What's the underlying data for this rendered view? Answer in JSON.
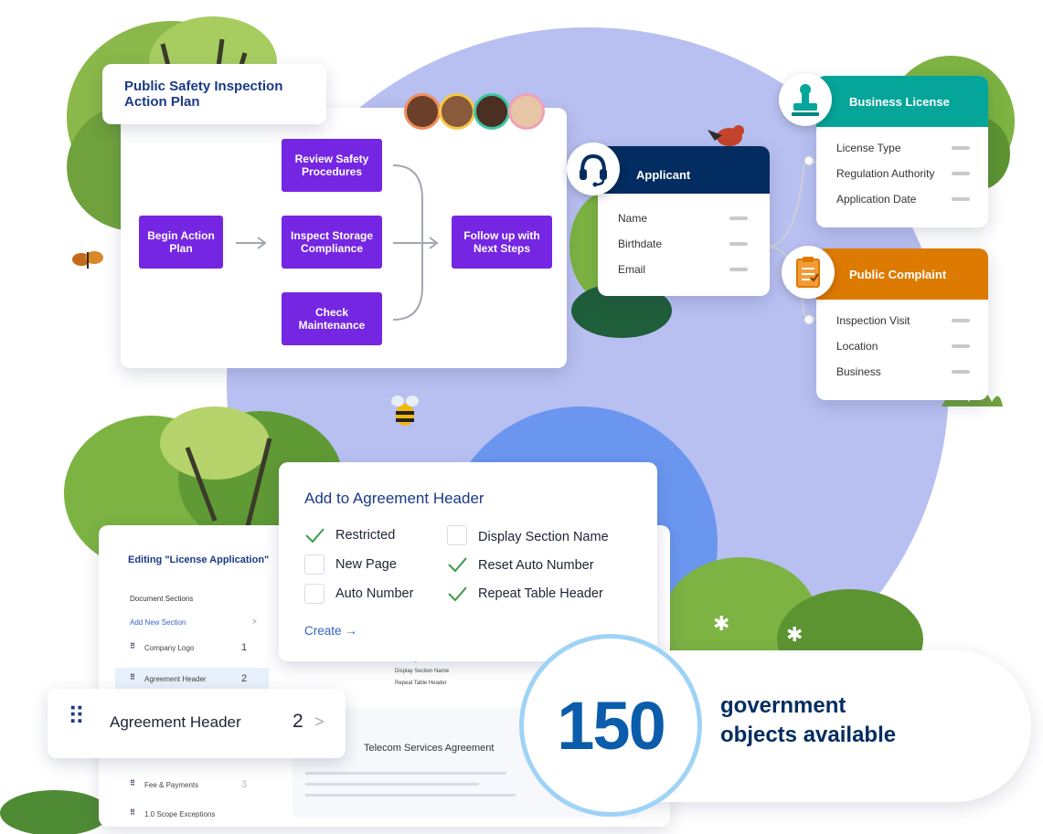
{
  "action_plan": {
    "title": "Public Safety Inspection Action Plan",
    "steps": {
      "begin": "Begin Action Plan",
      "review": "Review Safety Procedures",
      "inspect": "Inspect Storage Compliance",
      "check": "Check Maintenance",
      "follow": "Follow up with Next Steps"
    }
  },
  "applicant": {
    "title": "Applicant",
    "icon": "headset-icon",
    "color": "#032d60",
    "fields": [
      "Name",
      "Birthdate",
      "Email"
    ]
  },
  "business_license": {
    "title": "Business License",
    "icon": "stamp-icon",
    "color": "#06a59a",
    "fields": [
      "License Type",
      "Regulation Authority",
      "Application Date"
    ]
  },
  "public_complaint": {
    "title": "Public Complaint",
    "icon": "clipboard-icon",
    "color": "#dd7a01",
    "fields": [
      "Inspection Visit",
      "Location",
      "Business"
    ]
  },
  "agreement_popup": {
    "title": "Add to Agreement Header",
    "options": [
      {
        "label": "Restricted",
        "checked": true
      },
      {
        "label": "Display Section Name",
        "checked": false
      },
      {
        "label": "New Page",
        "checked": false
      },
      {
        "label": "Reset Auto Number",
        "checked": true
      },
      {
        "label": "Auto Number",
        "checked": false
      },
      {
        "label": "Repeat Table Header",
        "checked": true
      }
    ],
    "create_label": "Create →"
  },
  "editor": {
    "title": "Editing \"License Application\"",
    "sections_label": "Document Sections",
    "add_section": "Add New Section",
    "add_chevron": ">",
    "rows": [
      {
        "label": "Company Logo",
        "num": "1"
      },
      {
        "label": "Agreement Header",
        "num": "2"
      },
      {
        "label": "Fee & Payments",
        "num": "3"
      },
      {
        "label": "1.0 Scope Exceptions",
        "num": ""
      }
    ],
    "preview_items": [
      "New Page",
      "Display Section Name",
      "Repeat Table Header",
      "Reset Auto Number"
    ],
    "doc_title": "Telecom Services Agreement"
  },
  "agreement_chip": {
    "label": "Agreement Header",
    "num": "2",
    "chevron": ">"
  },
  "stat": {
    "number": "150",
    "line1": "government",
    "line2": "objects available"
  }
}
